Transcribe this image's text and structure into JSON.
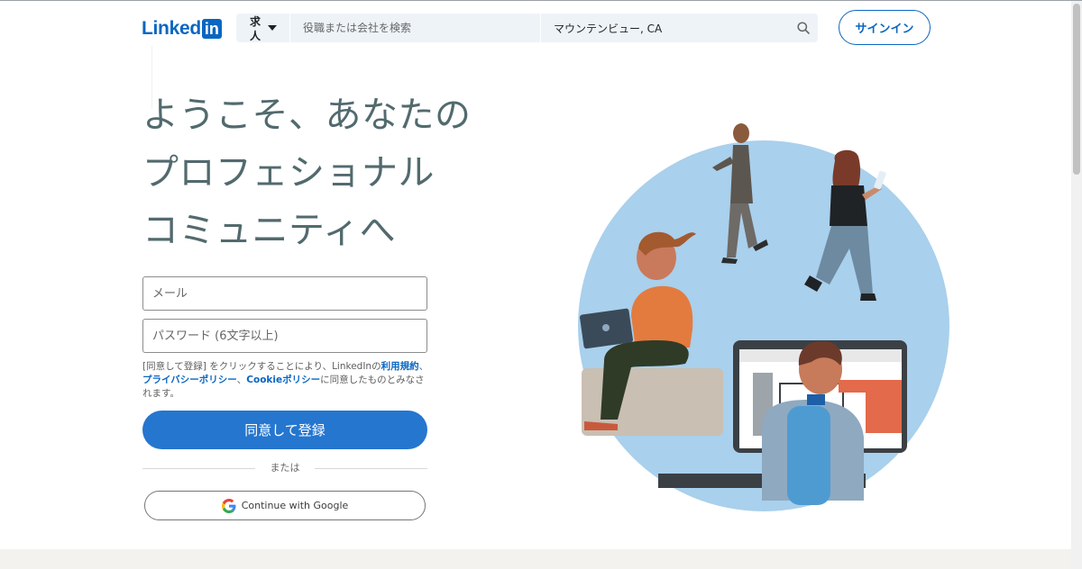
{
  "header": {
    "logo_text": "Linked",
    "logo_box": "in",
    "jobs_label": "求人",
    "keyword_placeholder": "役職または会社を検索",
    "location_value": "マウンテンビュー, CA",
    "signin_label": "サインイン"
  },
  "hero": {
    "title_lines": [
      "ようこそ、あなたの",
      "プロフェショナル",
      "コミュニティへ"
    ]
  },
  "form": {
    "email_placeholder": "メール",
    "password_placeholder": "パスワード (6文字以上)",
    "legal_prefix": "[同意して登録] をクリックすることにより、LinkedInの",
    "legal_link1": "利用規約",
    "legal_sep1": "、",
    "legal_link2": "プライバシーポリシー",
    "legal_sep2": "、",
    "legal_link3": "Cookieポリシー",
    "legal_suffix": "に同意したものとみなされます。",
    "join_label": "同意して登録",
    "or_label": "または",
    "google_label": "Continue with Google"
  },
  "colors": {
    "brand": "#0a66c2",
    "join_button": "#2576cf",
    "title": "#526a6e",
    "illustration_circle": "#a9d0ec"
  },
  "icons": [
    "search-icon",
    "chevron-down-icon",
    "google-icon"
  ]
}
